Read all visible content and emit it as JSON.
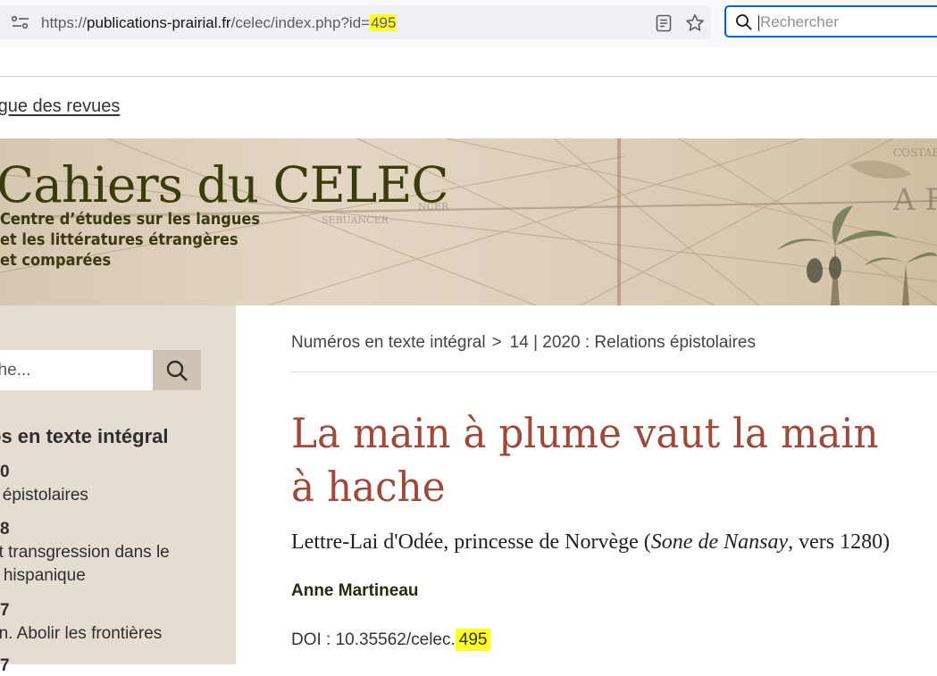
{
  "browser": {
    "url": {
      "scheme": "https://",
      "domain": "publications-prairial.fr",
      "path": "/celec/index.php?id=",
      "id_highlight": "495"
    },
    "search_placeholder": "Rechercher"
  },
  "site": {
    "catalogue_link": "logue des revues"
  },
  "banner": {
    "title": "Cahiers du CELEC",
    "subtitle_lines": [
      "Centre d’études sur les langues",
      "et les littératures étrangères",
      "et comparées"
    ]
  },
  "sidebar": {
    "search_placeholder": "che...",
    "heading": "os en texte intégral",
    "items": [
      {
        "num": "0",
        "lines": [
          "s épistolaires"
        ]
      },
      {
        "num": "8",
        "lines": [
          "et transgression dans le",
          "e hispanique"
        ]
      },
      {
        "num": "7",
        "lines": [
          "on. Abolir les frontières"
        ]
      },
      {
        "num": "7",
        "lines": []
      }
    ]
  },
  "main": {
    "breadcrumb": {
      "parent": "Numéros en texte intégral",
      "separator": ">",
      "current": "14 | 2020 : Relations épistolaires"
    },
    "title": "La main à plume vaut la main à hache",
    "subtitle": {
      "before": "Lettre-Lai d'Odée, princesse de Norvège (",
      "italic": "Sone de Nansay",
      "after": ", vers 1280)"
    },
    "author": "Anne Martineau",
    "doi": {
      "prefix": "DOI : 10.35562/celec.",
      "id_highlight": "495"
    }
  },
  "colors": {
    "highlight": "#ffff2e",
    "title": "#9b4a3b",
    "sidebar_bg": "#e6ddd2",
    "banner_text": "#3b3b0e"
  }
}
